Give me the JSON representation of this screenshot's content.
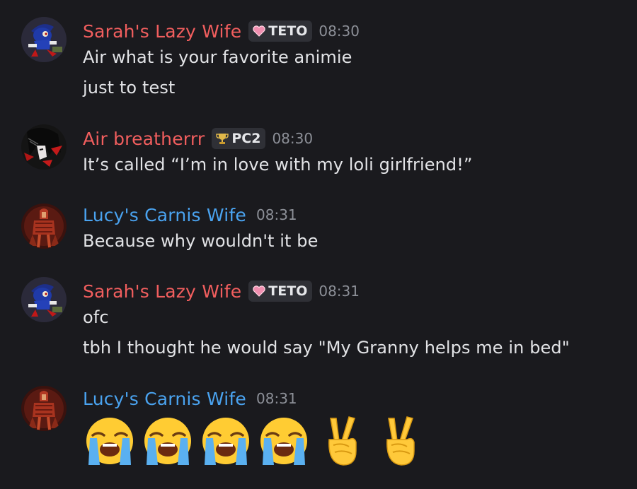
{
  "colors": {
    "background": "#1a1a1e",
    "username_red": "#f15e5e",
    "username_blue": "#4aa3f0",
    "timestamp": "#8d9098",
    "tag_bg": "#2f3036"
  },
  "messages": [
    {
      "author": "Sarah's Lazy Wife",
      "author_color": "#f15e5e",
      "avatar": "sonic-avatar",
      "tag": {
        "icon": "pink-heart-icon",
        "label": "TETO"
      },
      "time": "08:30",
      "lines": [
        "Air what is your favorite animie",
        "just to test"
      ]
    },
    {
      "author": "Air breatherrr",
      "author_color": "#f15e5e",
      "avatar": "anime-avatar",
      "tag": {
        "icon": "trophy-icon",
        "label": "PC2"
      },
      "time": "08:30",
      "lines": [
        "It’s called “I’m in love with my loli girlfriend!”"
      ]
    },
    {
      "author": "Lucy's Carnis Wife",
      "author_color": "#4aa3f0",
      "avatar": "carnis-avatar",
      "time": "08:31",
      "lines": [
        "Because why wouldn't it be"
      ]
    },
    {
      "author": "Sarah's Lazy Wife",
      "author_color": "#f15e5e",
      "avatar": "sonic-avatar",
      "tag": {
        "icon": "pink-heart-icon",
        "label": "TETO"
      },
      "time": "08:31",
      "lines": [
        "ofc",
        "tbh I thought he would say \"My Granny helps me in bed\""
      ]
    },
    {
      "author": "Lucy's Carnis Wife",
      "author_color": "#4aa3f0",
      "avatar": "carnis-avatar",
      "time": "08:31",
      "emojis": [
        "loudly-crying-face",
        "loudly-crying-face",
        "loudly-crying-face",
        "loudly-crying-face",
        "victory-hand",
        "victory-hand"
      ]
    }
  ]
}
